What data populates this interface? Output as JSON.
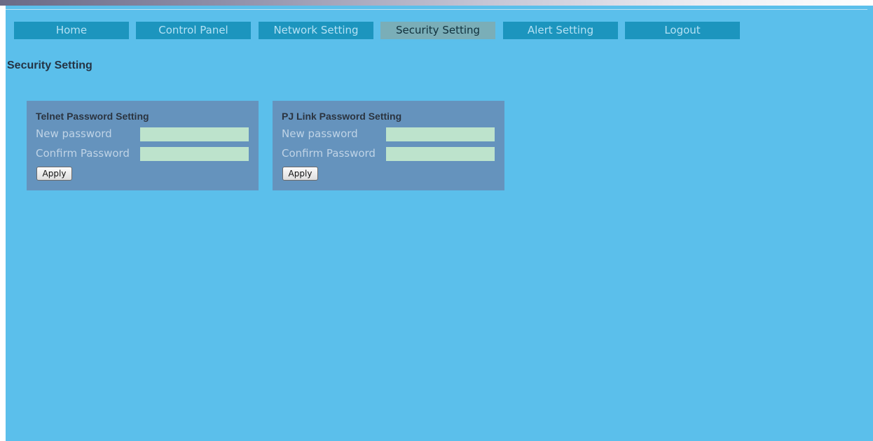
{
  "nav": {
    "tabs": [
      {
        "label": "Home",
        "active": false
      },
      {
        "label": "Control Panel",
        "active": false
      },
      {
        "label": "Network Setting",
        "active": false
      },
      {
        "label": "Security Setting",
        "active": true
      },
      {
        "label": "Alert Setting",
        "active": false
      },
      {
        "label": "Logout",
        "active": false
      }
    ]
  },
  "page": {
    "title": "Security Setting"
  },
  "panels": {
    "telnet": {
      "title": "Telnet Password Setting",
      "new_password_label": "New password",
      "new_password_value": "",
      "confirm_password_label": "Confirm Password",
      "confirm_password_value": "",
      "apply_label": "Apply"
    },
    "pjlink": {
      "title": "PJ Link Password Setting",
      "new_password_label": "New password",
      "new_password_value": "",
      "confirm_password_label": "Confirm Password",
      "confirm_password_value": "",
      "apply_label": "Apply"
    }
  },
  "colors": {
    "page_background": "#5bbfeb",
    "nav_tab": "#1c95be",
    "nav_tab_active": "#7aaeb8",
    "panel_background": "#6593bd",
    "input_background": "#bde3cc"
  }
}
